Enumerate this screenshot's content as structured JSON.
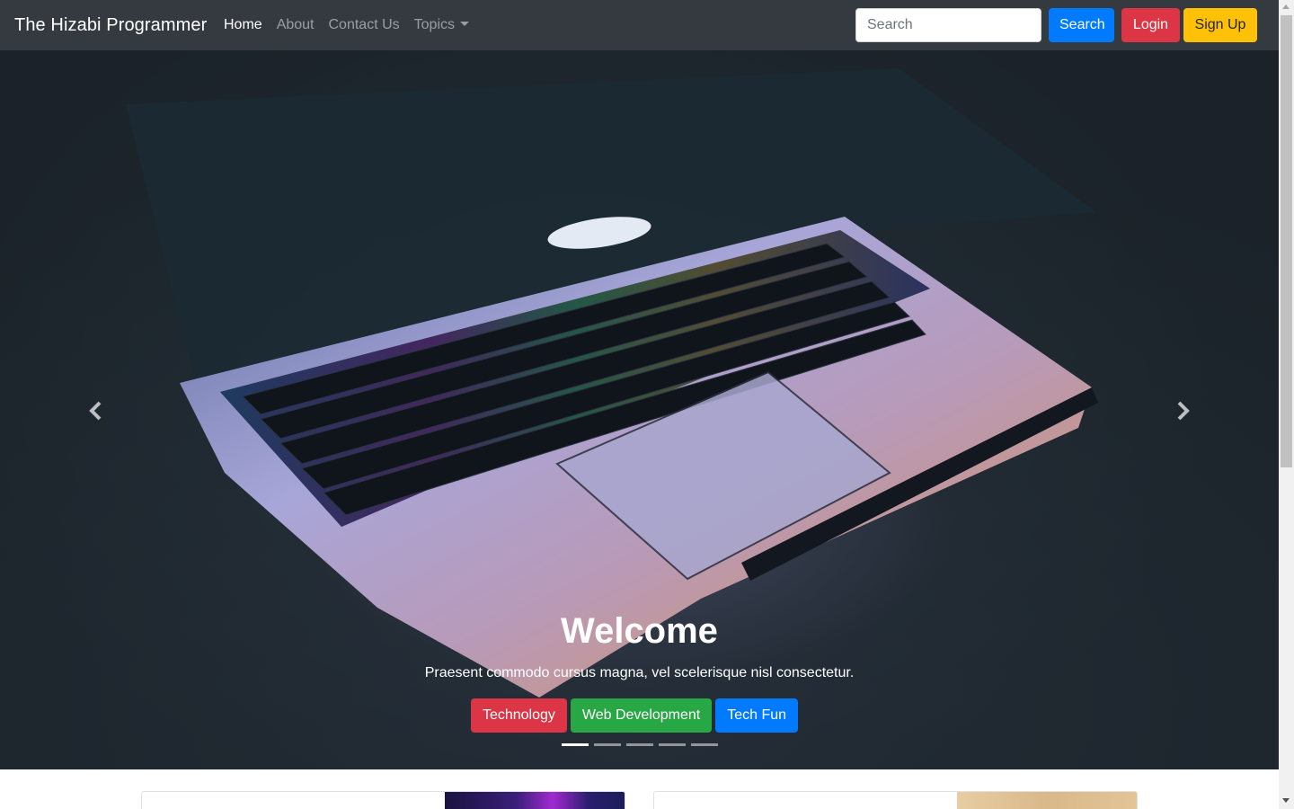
{
  "navbar": {
    "brand": "The Hizabi Programmer",
    "links": [
      {
        "label": "Home",
        "active": true
      },
      {
        "label": "About",
        "active": false
      },
      {
        "label": "Contact Us",
        "active": false
      },
      {
        "label": "Topics",
        "active": false,
        "dropdown": true
      }
    ],
    "search": {
      "placeholder": "Search",
      "value": ""
    },
    "buttons": {
      "search": "Search",
      "login": "Login",
      "signup": "Sign Up"
    }
  },
  "carousel": {
    "caption_title": "Welcome",
    "caption_text": "Praesent commodo cursus magna, vel scelerisque nisl consectetur.",
    "buttons": [
      {
        "label": "Technology",
        "color": "#dc3545"
      },
      {
        "label": "Web Development",
        "color": "#28a745"
      },
      {
        "label": "Tech Fun",
        "color": "#007bff"
      }
    ],
    "indicator_count": 5,
    "active_indicator": 0,
    "prev_icon": "chevron-left-icon",
    "next_icon": "chevron-right-icon"
  },
  "colors": {
    "navbar_bg": "#343a40",
    "primary": "#007bff",
    "danger": "#dc3545",
    "success": "#28a745",
    "warning": "#ffc107"
  }
}
